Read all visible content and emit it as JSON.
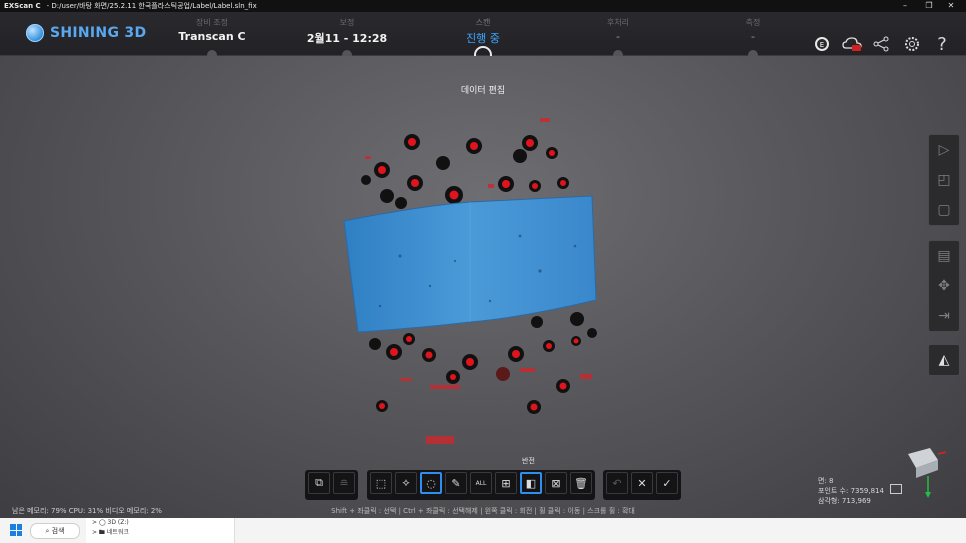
{
  "title_bar": {
    "app": "EXScan C",
    "path": "- D:/user/바탕 화면/25.2.11 한국플라스틱공업/Label/Label.sln_fix",
    "controls": [
      "–",
      "❐",
      "✕"
    ]
  },
  "header": {
    "brand": "SHINING 3D",
    "steps": [
      {
        "label": "장비 조정",
        "value": "Transcan C",
        "state": "done"
      },
      {
        "label": "보정",
        "value": "2월11 - 12:28",
        "state": "done"
      },
      {
        "label": "스캔",
        "value": "진행 중",
        "state": "active"
      },
      {
        "label": "후처리",
        "value": "-",
        "state": "pending"
      },
      {
        "label": "측정",
        "value": "-",
        "state": "pending"
      }
    ],
    "icons": [
      "language-icon",
      "cloud-icon",
      "share-icon",
      "settings-icon",
      "help-icon"
    ]
  },
  "viewport": {
    "title": "데이터 편집",
    "tooltip": "반전"
  },
  "toolbar": {
    "groups": [
      [
        "view-cube-icon",
        "layers-icon"
      ],
      [
        "rect-select-icon",
        "polygon-select-icon",
        "lasso-select-icon",
        "brush-select-icon"
      ],
      [
        "select-all-icon",
        "expand-select-icon",
        "invert-select-icon",
        "deselect-icon",
        "delete-icon"
      ],
      [
        "undo-icon",
        "cancel-icon",
        "confirm-icon"
      ]
    ],
    "select_all_label": "ALL"
  },
  "status": {
    "memory": "남은 메모리: 79% CPU: 31% 비디오 메모리: 2%",
    "hint": "Shift + 좌클릭 : 선택 | Ctrl + 좌클릭 : 선택해제 | 왼쪽 클릭 : 회전 | 휠 클릭 : 이동 | 스크롤 휠 : 확대",
    "stats_lines": [
      "면: 8",
      "포인트 수: 7359,814",
      "삼각형: 713,969"
    ]
  },
  "taskbar": {
    "search": "검색",
    "explorer_items": [
      "> ◯ 3D (Z:)",
      "> 🖿 네트워크"
    ]
  },
  "colors": {
    "accent": "#3da6ff",
    "scan_blue": "#3f8fd0",
    "marker_red": "#e0141c"
  }
}
